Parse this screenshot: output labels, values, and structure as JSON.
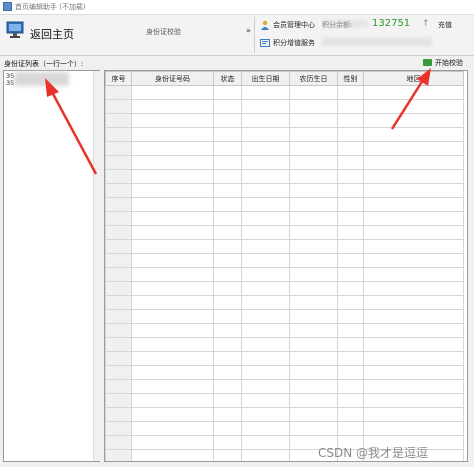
{
  "window": {
    "title": "首页编辑助手 (不加载)"
  },
  "toolbar": {
    "home_label": "返回主页",
    "center_tab_label": "身份证校验",
    "collapse_arrow": "»",
    "member_center": "会员管理中心",
    "balance_label": "积分余额:",
    "balance_value": "132751",
    "up_arrow": "↑",
    "recharge": "充值",
    "points_service": "积分增值服务"
  },
  "left_panel": {
    "label": "身份证列表（一行一个）:",
    "lines": [
      "35",
      "35"
    ]
  },
  "start_button": {
    "label": "开始校验",
    "icon": "play-icon",
    "color": "#3a9a3a"
  },
  "table": {
    "columns": [
      "序号",
      "身份证号码",
      "状态",
      "出生日期",
      "农历生日",
      "性别",
      "地区"
    ],
    "row_count": 27
  },
  "watermark": "CSDN @我才是逗逗",
  "colors": {
    "balance_green": "#2a9a2a",
    "annotation_red": "#e8332c"
  }
}
